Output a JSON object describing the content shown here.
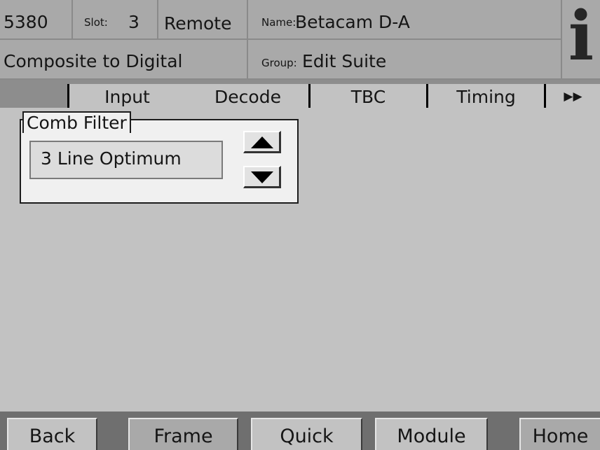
{
  "header": {
    "model": "5380",
    "slot_label": "Slot:",
    "slot_value": "3",
    "mode": "Remote",
    "name_label": "Name:",
    "name_value": "Betacam D-A",
    "description": "Composite to Digital",
    "group_label": "Group:",
    "group_value": "Edit Suite",
    "info_glyph": "i",
    "info_icon": "info-icon"
  },
  "tabs": [
    {
      "label": "Input"
    },
    {
      "label": "Decode",
      "selected": true
    },
    {
      "label": "TBC"
    },
    {
      "label": "Timing"
    }
  ],
  "more_tabs": {
    "glyph": "▶▶",
    "icon": "double-right-arrow-icon"
  },
  "comb_filter": {
    "label": "Comb Filter",
    "value": "3 Line Optimum",
    "up_icon": "up-arrow-icon",
    "down_icon": "down-arrow-icon"
  },
  "footer": {
    "back": "Back",
    "frame": "Frame",
    "quick": "Quick",
    "module": "Module",
    "home": "Home"
  },
  "colors": {
    "background": "#c2c2c2",
    "header": "#a9a9a9",
    "panel": "#f0f0f0"
  }
}
